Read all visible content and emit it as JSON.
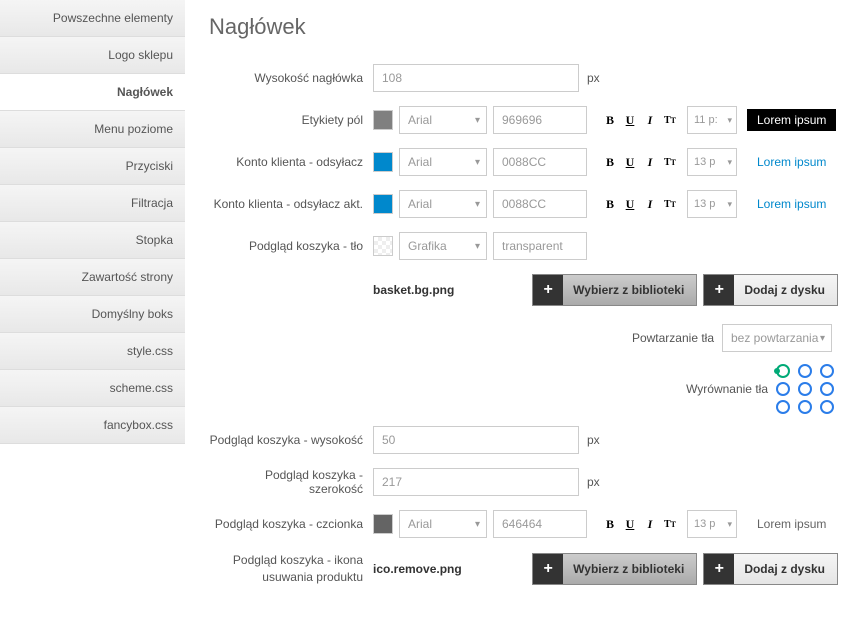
{
  "sidebar": {
    "items": [
      {
        "label": "Powszechne elementy"
      },
      {
        "label": "Logo sklepu"
      },
      {
        "label": "Nagłówek"
      },
      {
        "label": "Menu poziome"
      },
      {
        "label": "Przyciski"
      },
      {
        "label": "Filtracja"
      },
      {
        "label": "Stopka"
      },
      {
        "label": "Zawartość strony"
      },
      {
        "label": "Domyślny boks"
      },
      {
        "label": "style.css"
      },
      {
        "label": "scheme.css"
      },
      {
        "label": "fancybox.css"
      }
    ]
  },
  "page": {
    "title": "Nagłówek"
  },
  "fields": {
    "heightLabel": "Wysokość nagłówka",
    "heightValue": "108",
    "px": "px",
    "labelsLabel": "Etykiety pól",
    "labelsColor": "#808080",
    "labelsFont": "Arial",
    "labelsHex": "969696",
    "labelsSize": "11 p:",
    "labelsPreview": "Lorem ipsum",
    "accLabel": "Konto klienta - odsyłacz",
    "accColor": "#0088CC",
    "accFont": "Arial",
    "accHex": "0088CC",
    "accSize": "13 p",
    "accPreview": "Lorem ipsum",
    "accActLabel": "Konto klienta - odsyłacz akt.",
    "accActColor": "#0088CC",
    "accActFont": "Arial",
    "accActHex": "0088CC",
    "accActSize": "13 p",
    "accActPreview": "Lorem ipsum",
    "bgLabel": "Podgląd koszyka - tło",
    "bgFont": "Grafika",
    "bgHex": "transparent",
    "bgFile": "basket.bg.png",
    "btnLib": "Wybierz z biblioteki",
    "btnDisk": "Dodaj z dysku",
    "repeatLabel": "Powtarzanie tła",
    "repeatValue": "bez powtarzania",
    "alignLabel": "Wyrównanie tła",
    "basketHLabel": "Podgląd koszyka - wysokość",
    "basketHValue": "50",
    "basketWLabel": "Podgląd koszyka - szerokość",
    "basketWValue": "217",
    "basketFontLabel": "Podgląd koszyka - czcionka",
    "basketFontColor": "#646464",
    "basketFont": "Arial",
    "basketHex": "646464",
    "basketSize": "13 p",
    "basketPreview": "Lorem ipsum",
    "iconLabel1": "Podgląd koszyka - ikona",
    "iconLabel2": "usuwania produktu",
    "iconFile": "ico.remove.png"
  }
}
